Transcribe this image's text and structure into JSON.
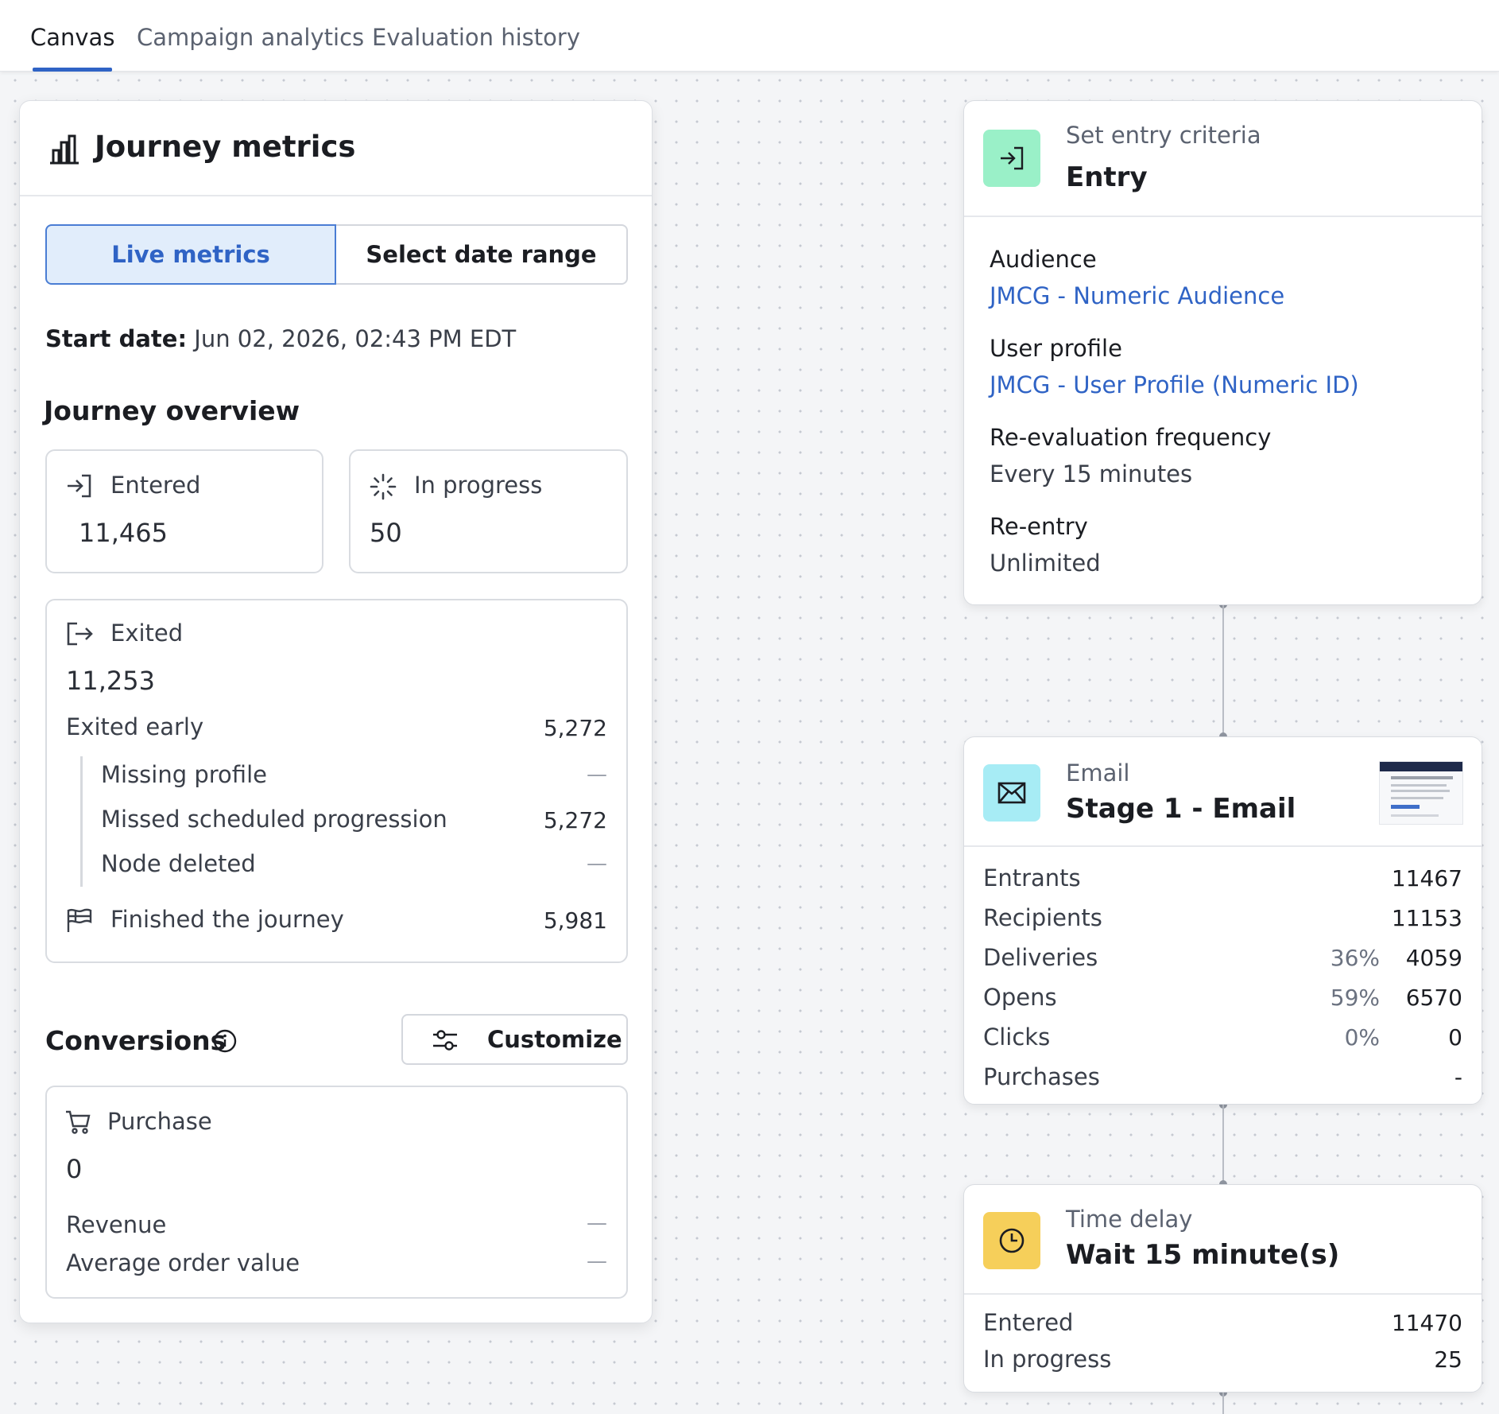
{
  "tabs": [
    "Canvas",
    "Campaign analytics",
    "Evaluation history"
  ],
  "metrics": {
    "title": "Journey metrics",
    "live_label": "Live metrics",
    "range_label": "Select date range",
    "start_label": "Start date:",
    "start_value": "Jun 02, 2026, 02:43 PM EDT",
    "overview_title": "Journey overview",
    "entered_label": "Entered",
    "entered_value": "11,465",
    "in_progress_label": "In progress",
    "in_progress_value": "50",
    "exited_label": "Exited",
    "exited_value": "11,253",
    "exited_early_label": "Exited early",
    "exited_early_value": "5,272",
    "missing_profile_label": "Missing profile",
    "missing_profile_value": "—",
    "missed_prog_label": "Missed scheduled progression",
    "missed_prog_value": "5,272",
    "node_deleted_label": "Node deleted",
    "node_deleted_value": "—",
    "finished_label": "Finished the journey",
    "finished_value": "5,981"
  },
  "conversions": {
    "title": "Conversions",
    "customize_label": "Customize",
    "purchase_label": "Purchase",
    "purchase_value": "0",
    "revenue_label": "Revenue",
    "revenue_value": "—",
    "aov_label": "Average order value",
    "aov_value": "—"
  },
  "entry_node": {
    "subtitle": "Set entry criteria",
    "title": "Entry",
    "audience_label": "Audience",
    "audience_value": "JMCG - Numeric Audience",
    "profile_label": "User profile",
    "profile_value": "JMCG - User Profile (Numeric ID)",
    "reeval_label": "Re-evaluation frequency",
    "reeval_value": "Every 15 minutes",
    "reentry_label": "Re-entry",
    "reentry_value": "Unlimited"
  },
  "email_node": {
    "subtitle": "Email",
    "title": "Stage 1 - Email",
    "rows": [
      {
        "label": "Entrants",
        "pct": "",
        "value": "11467"
      },
      {
        "label": "Recipients",
        "pct": "",
        "value": "11153"
      },
      {
        "label": "Deliveries",
        "pct": "36%",
        "value": "4059"
      },
      {
        "label": "Opens",
        "pct": "59%",
        "value": "6570"
      },
      {
        "label": "Clicks",
        "pct": "0%",
        "value": "0"
      },
      {
        "label": "Purchases",
        "pct": "",
        "value": "-"
      }
    ]
  },
  "delay_node": {
    "subtitle": "Time delay",
    "title": "Wait 15 minute(s)",
    "entered_label": "Entered",
    "entered_value": "11470",
    "in_progress_label": "In progress",
    "in_progress_value": "25"
  },
  "colors": {
    "accent": "#2f63c5",
    "entry_icon_bg": "#9af0c8",
    "email_icon_bg": "#a7ecf5",
    "delay_icon_bg": "#f6cf5a"
  },
  "icons": [
    "bar-chart-icon",
    "enter-icon",
    "spinner-icon",
    "exit-icon",
    "flag-icon",
    "info-icon",
    "sliders-icon",
    "cart-icon",
    "envelope-icon",
    "clock-icon"
  ]
}
